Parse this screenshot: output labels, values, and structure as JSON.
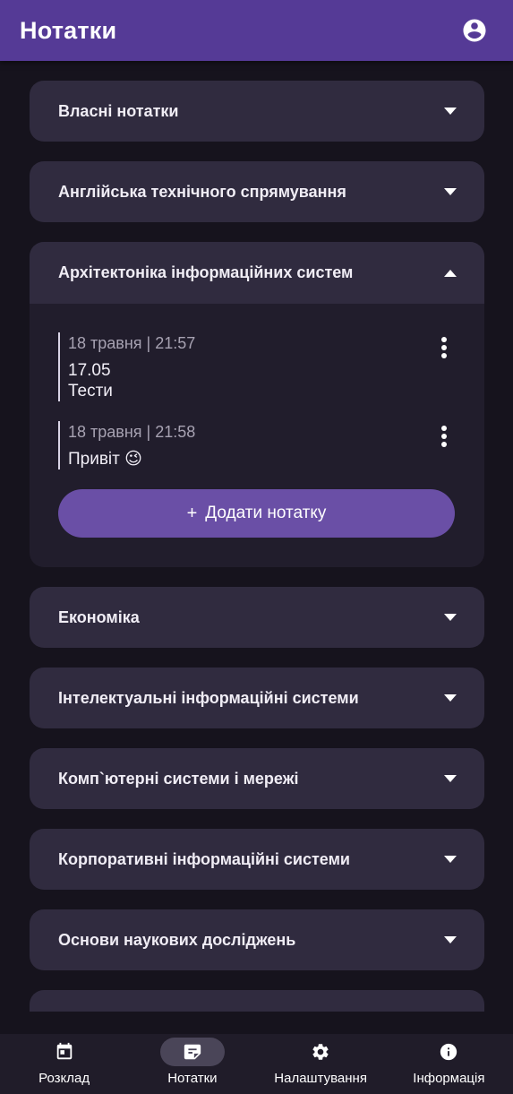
{
  "appbar": {
    "title": "Нотатки",
    "icon": "account-circle-icon"
  },
  "sections": [
    {
      "title": "Власні нотатки",
      "expanded": false
    },
    {
      "title": "Англійська технічного спрямування",
      "expanded": false
    },
    {
      "title": "Архітектоніка інформаційних систем",
      "expanded": true
    },
    {
      "title": "Економіка",
      "expanded": false
    },
    {
      "title": "Інтелектуальні інформаційні системи",
      "expanded": false
    },
    {
      "title": "Комп`ютерні системи і мережі",
      "expanded": false
    },
    {
      "title": "Корпоративні інформаційні системи",
      "expanded": false
    },
    {
      "title": "Основи наукових досліджень",
      "expanded": false
    }
  ],
  "notes": [
    {
      "meta": "18 травня | 21:57",
      "text": "17.05\nТести"
    },
    {
      "meta": "18 травня | 21:58",
      "text": "Привіт 😉"
    }
  ],
  "add_note": {
    "plus": "+",
    "label": "Додати нотатку"
  },
  "nav": [
    {
      "label": "Розклад",
      "icon": "calendar-icon",
      "active": false
    },
    {
      "label": "Нотатки",
      "icon": "notes-icon",
      "active": true
    },
    {
      "label": "Налаштування",
      "icon": "gear-icon",
      "active": false
    },
    {
      "label": "Інформація",
      "icon": "info-icon",
      "active": false
    }
  ],
  "colors": {
    "appbar": "#553a96",
    "background": "#16131d",
    "card": "#302b3f",
    "expanded_body": "#211d2c",
    "accent_button": "#6a4fa6",
    "bottom_nav": "#201c29"
  }
}
